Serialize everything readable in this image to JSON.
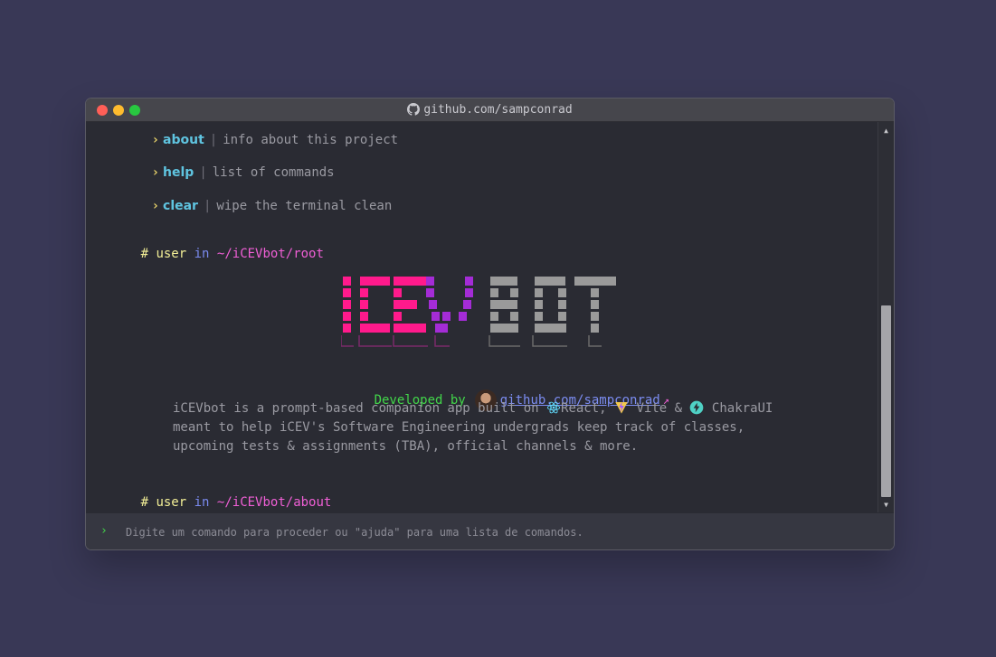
{
  "window": {
    "title": "github.com/sampconrad",
    "controls": [
      "close",
      "minimize",
      "maximize"
    ]
  },
  "commands": [
    {
      "name": "about",
      "description": "info about this project"
    },
    {
      "name": "help",
      "description": "list of commands"
    },
    {
      "name": "clear",
      "description": "wipe the terminal clean"
    }
  ],
  "prompt_root": {
    "hash": "#",
    "user": "user",
    "in": "in",
    "path": "~/iCEVbot/root"
  },
  "banner": {
    "text": "iCEV BOT"
  },
  "developer": {
    "label": "Developed by",
    "link": "github.com/sampconrad",
    "external_icon": "external-link-icon"
  },
  "description": {
    "line1_prefix": "iCEVbot is a prompt-based companion app built on",
    "react": "React,",
    "vite": "Vite &",
    "chakra": "ChakraUI",
    "line2": "meant to help iCEV's Software Engineering undergrads keep track of classes,",
    "line3": "upcoming tests & assignments (TBA), official channels & more."
  },
  "prompt_about": {
    "hash": "#",
    "user": "user",
    "in": "in",
    "path": "~/iCEVbot/about"
  },
  "input": {
    "chevron": "›",
    "placeholder": "Digite um comando para proceder ou \"ajuda\" para uma lista de comandos."
  },
  "colors": {
    "background": "#393856",
    "terminal": "#2a2b33",
    "prompt_path": "#f05fd6",
    "command_name": "#5fc4e0",
    "developed_by": "#42d64a",
    "banner_icev": "#ff1a8c",
    "banner_bot": "#9a9a9a"
  }
}
